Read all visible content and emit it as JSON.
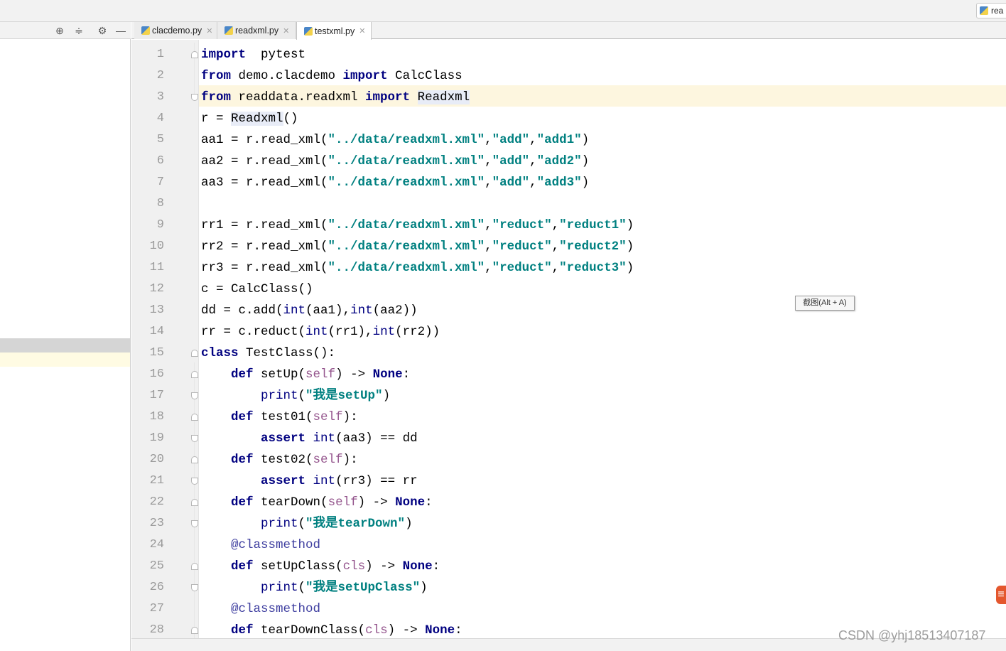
{
  "run_config": {
    "label": "rea"
  },
  "side_toolbar": {
    "icons": [
      "locate-icon",
      "collapse-icon",
      "gear-icon",
      "minimize-icon"
    ],
    "glyphs": [
      "⊕",
      "≑",
      "⚙",
      "—"
    ]
  },
  "tabs": [
    {
      "label": "clacdemo.py",
      "active": false
    },
    {
      "label": "readxml.py",
      "active": false
    },
    {
      "label": "testxml.py",
      "active": true
    }
  ],
  "editor": {
    "current_line": 3,
    "lines": [
      {
        "n": "1",
        "fold": "dn",
        "html": "<span class=\"kw\">import</span>  pytest"
      },
      {
        "n": "2",
        "html": "<span class=\"kw\">from</span> demo.clacdemo <span class=\"kw\">import</span> CalcClass"
      },
      {
        "n": "3",
        "fold": "up",
        "html": "<span class=\"kw\">from</span> readdata.readxml <span class=\"kw\">import</span> <span class=\"cls-hl\">Readxml</span>"
      },
      {
        "n": "4",
        "html": "r = <span class=\"cls-hl\">Readxml</span>()"
      },
      {
        "n": "5",
        "html": "aa1 = r.read_xml(<span class=\"s\">\"../data/readxml.xml\"</span>,<span class=\"s\">\"add\"</span>,<span class=\"s\">\"add1\"</span>)"
      },
      {
        "n": "6",
        "html": "aa2 = r.read_xml(<span class=\"s\">\"../data/readxml.xml\"</span>,<span class=\"s\">\"add\"</span>,<span class=\"s\">\"add2\"</span>)"
      },
      {
        "n": "7",
        "html": "aa3 = r.read_xml(<span class=\"s\">\"../data/readxml.xml\"</span>,<span class=\"s\">\"add\"</span>,<span class=\"s\">\"add3\"</span>)"
      },
      {
        "n": "8",
        "html": ""
      },
      {
        "n": "9",
        "html": "rr1 = r.read_xml(<span class=\"s\">\"../data/readxml.xml\"</span>,<span class=\"s\">\"reduct\"</span>,<span class=\"s\">\"reduct1\"</span>)"
      },
      {
        "n": "10",
        "html": "rr2 = r.read_xml(<span class=\"s\">\"../data/readxml.xml\"</span>,<span class=\"s\">\"reduct\"</span>,<span class=\"s\">\"reduct2\"</span>)"
      },
      {
        "n": "11",
        "html": "rr3 = r.read_xml(<span class=\"s\">\"../data/readxml.xml\"</span>,<span class=\"s\">\"reduct\"</span>,<span class=\"s\">\"reduct3\"</span>)"
      },
      {
        "n": "12",
        "html": "c = CalcClass()"
      },
      {
        "n": "13",
        "html": "dd = c.add(<span class=\"bi\">int</span>(aa1),<span class=\"bi\">int</span>(aa2))"
      },
      {
        "n": "14",
        "html": "rr = c.reduct(<span class=\"bi\">int</span>(rr1),<span class=\"bi\">int</span>(rr2))"
      },
      {
        "n": "15",
        "fold": "dn",
        "html": "<span class=\"kw\">class</span> TestClass():"
      },
      {
        "n": "16",
        "fold": "dn",
        "html": "    <span class=\"kw\">def</span> setUp(<span class=\"sf\">self</span>) -&gt; <span class=\"kw\">None</span>:"
      },
      {
        "n": "17",
        "fold": "up",
        "html": "        <span class=\"bi\">print</span>(<span class=\"s\">\"我是setUp\"</span>)"
      },
      {
        "n": "18",
        "fold": "dn",
        "html": "    <span class=\"kw\">def</span> test01(<span class=\"sf\">self</span>):"
      },
      {
        "n": "19",
        "fold": "up",
        "html": "        <span class=\"kw\">assert</span> <span class=\"bi\">int</span>(aa3) == dd"
      },
      {
        "n": "20",
        "fold": "dn",
        "html": "    <span class=\"kw\">def</span> test02(<span class=\"sf\">self</span>):"
      },
      {
        "n": "21",
        "fold": "up",
        "html": "        <span class=\"kw\">assert</span> <span class=\"bi\">int</span>(rr3) == rr"
      },
      {
        "n": "22",
        "fold": "dn",
        "html": "    <span class=\"kw\">def</span> tearDown(<span class=\"sf\">self</span>) -&gt; <span class=\"kw\">None</span>:"
      },
      {
        "n": "23",
        "fold": "up",
        "html": "        <span class=\"bi\">print</span>(<span class=\"s\">\"我是tearDown\"</span>)"
      },
      {
        "n": "24",
        "html": "    <span class=\"dec\">@classmethod</span>"
      },
      {
        "n": "25",
        "fold": "dn",
        "html": "    <span class=\"kw\">def</span> setUpClass(<span class=\"sf\">cls</span>) -&gt; <span class=\"kw\">None</span>:"
      },
      {
        "n": "26",
        "fold": "up",
        "html": "        <span class=\"bi\">print</span>(<span class=\"s\">\"我是setUpClass\"</span>)"
      },
      {
        "n": "27",
        "html": "    <span class=\"dec\">@classmethod</span>"
      },
      {
        "n": "28",
        "fold": "dn",
        "html": "    <span class=\"kw\">def</span> tearDownClass(<span class=\"sf\">cls</span>) -&gt; <span class=\"kw\">None</span>:"
      }
    ]
  },
  "tooltip": {
    "text": "截图(Alt + A)"
  },
  "watermark": {
    "text": "CSDN @yhj18513407187"
  },
  "badge": {
    "glyph": "≡"
  }
}
